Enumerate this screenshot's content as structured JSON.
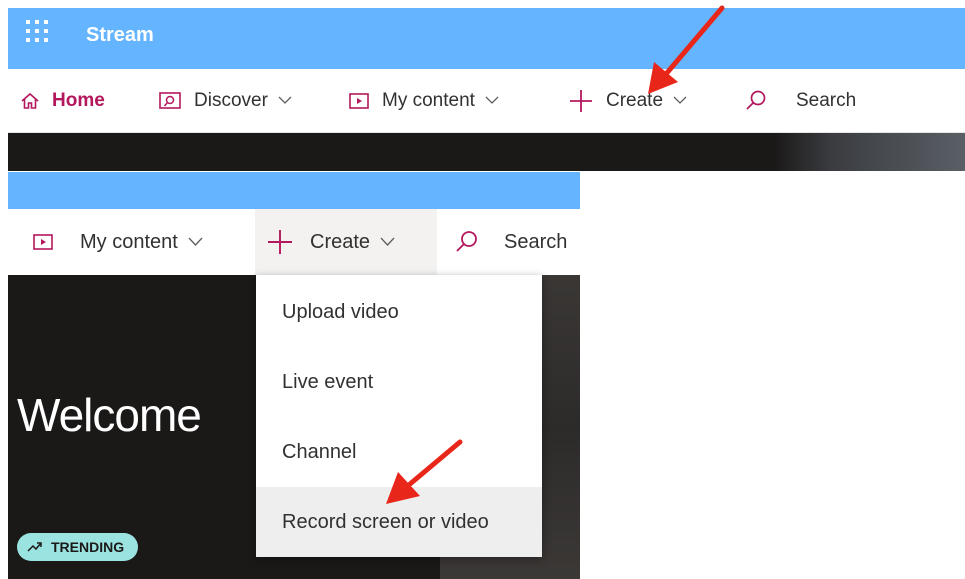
{
  "app": {
    "title": "Stream"
  },
  "top_nav": {
    "home": "Home",
    "discover": "Discover",
    "my_content": "My content",
    "create": "Create",
    "search": "Search"
  },
  "bottom_nav": {
    "my_content": "My content",
    "create": "Create",
    "search": "Search"
  },
  "create_menu": {
    "items": [
      "Upload video",
      "Live event",
      "Channel",
      "Record screen or video"
    ],
    "highlighted": "Record screen or video"
  },
  "hero": {
    "welcome": "Welcome",
    "badge": "TRENDING"
  },
  "icons": {
    "app_launcher": "waffle-icon",
    "home": "home-icon",
    "discover": "discover-icon",
    "my_content": "video-icon",
    "create": "plus-icon",
    "search": "search-icon",
    "trending": "trend-up-icon",
    "annotation": "red-arrow"
  },
  "colors": {
    "header": "#64b4ff",
    "accent": "#b4185c",
    "hero_bg": "#1b1918",
    "badge_bg": "#9ae3e0",
    "arrow": "#e8261a"
  }
}
